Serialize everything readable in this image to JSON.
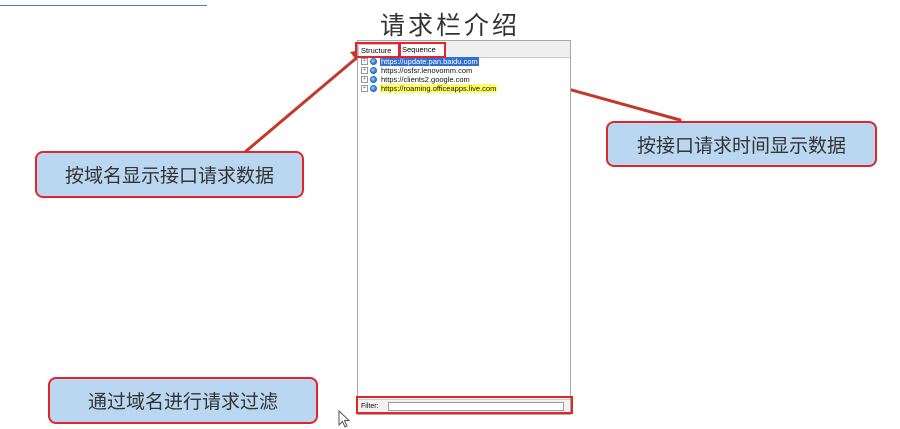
{
  "slide": {
    "title": "请求栏介绍"
  },
  "app": {
    "tabs": [
      {
        "label": "Structure",
        "active": true
      },
      {
        "label": "Sequence",
        "active": false
      }
    ],
    "hosts": [
      {
        "label": "https://update.pan.baidu.com",
        "state": "selected"
      },
      {
        "label": "https://osfsr.lenovomm.com",
        "state": "normal"
      },
      {
        "label": "https://clients2.google.com",
        "state": "normal"
      },
      {
        "label": "https://roaming.officeapps.live.com",
        "state": "highlighted"
      }
    ],
    "expander_glyph": "+",
    "filter": {
      "label": "Filter:",
      "value": ""
    }
  },
  "callouts": {
    "by_domain": "按域名显示接口请求数据",
    "by_time": "按接口请求时间显示数据",
    "filter": "通过域名进行请求过滤"
  },
  "colors": {
    "annotation_red": "#e3242b",
    "callout_fill": "#b9d7f0",
    "selection_blue": "#2f6fd6",
    "highlight_yellow": "#ffff66"
  },
  "icons": {
    "host": "globe-icon",
    "pointer": "mouse-cursor-icon"
  }
}
